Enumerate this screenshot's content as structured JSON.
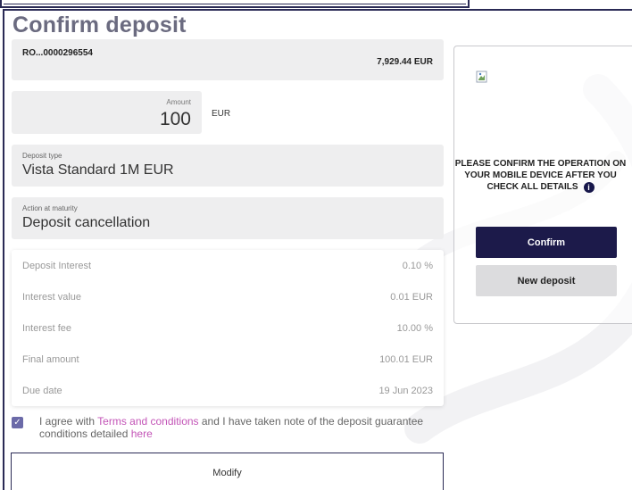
{
  "page": {
    "title": "Confirm deposit"
  },
  "account": {
    "number": "RO...0000296554",
    "balance": "7,929.44 EUR"
  },
  "amount": {
    "label": "Amount",
    "value": "100",
    "currency": "EUR"
  },
  "deposit_type": {
    "label": "Deposit type",
    "value": "Vista Standard 1M EUR"
  },
  "action_at_maturity": {
    "label": "Action at maturity",
    "value": "Deposit cancellation"
  },
  "details": [
    {
      "label": "Deposit Interest",
      "value": "0.10 %"
    },
    {
      "label": "Interest value",
      "value": "0.01 EUR"
    },
    {
      "label": "Interest fee",
      "value": "10.00 %"
    },
    {
      "label": "Final amount",
      "value": "100.01 EUR"
    },
    {
      "label": "Due date",
      "value": "19 Jun 2023"
    }
  ],
  "agreement": {
    "checked": true,
    "text_before": "I agree with ",
    "terms_link": "Terms and conditions",
    "text_middle": " and I have taken note of the deposit guarantee conditions detailed ",
    "here_link": "here"
  },
  "buttons": {
    "modify": "Modify",
    "confirm": "Confirm",
    "new_deposit": "New deposit"
  },
  "confirm_panel": {
    "message": "PLEASE CONFIRM THE OPERATION ON YOUR MOBILE DEVICE AFTER YOU CHECK ALL DETAILS"
  },
  "colors": {
    "primary": "#1c1a4a",
    "link": "#c354b7",
    "checkbox": "#6b6aa8",
    "title": "#6b6b80"
  }
}
